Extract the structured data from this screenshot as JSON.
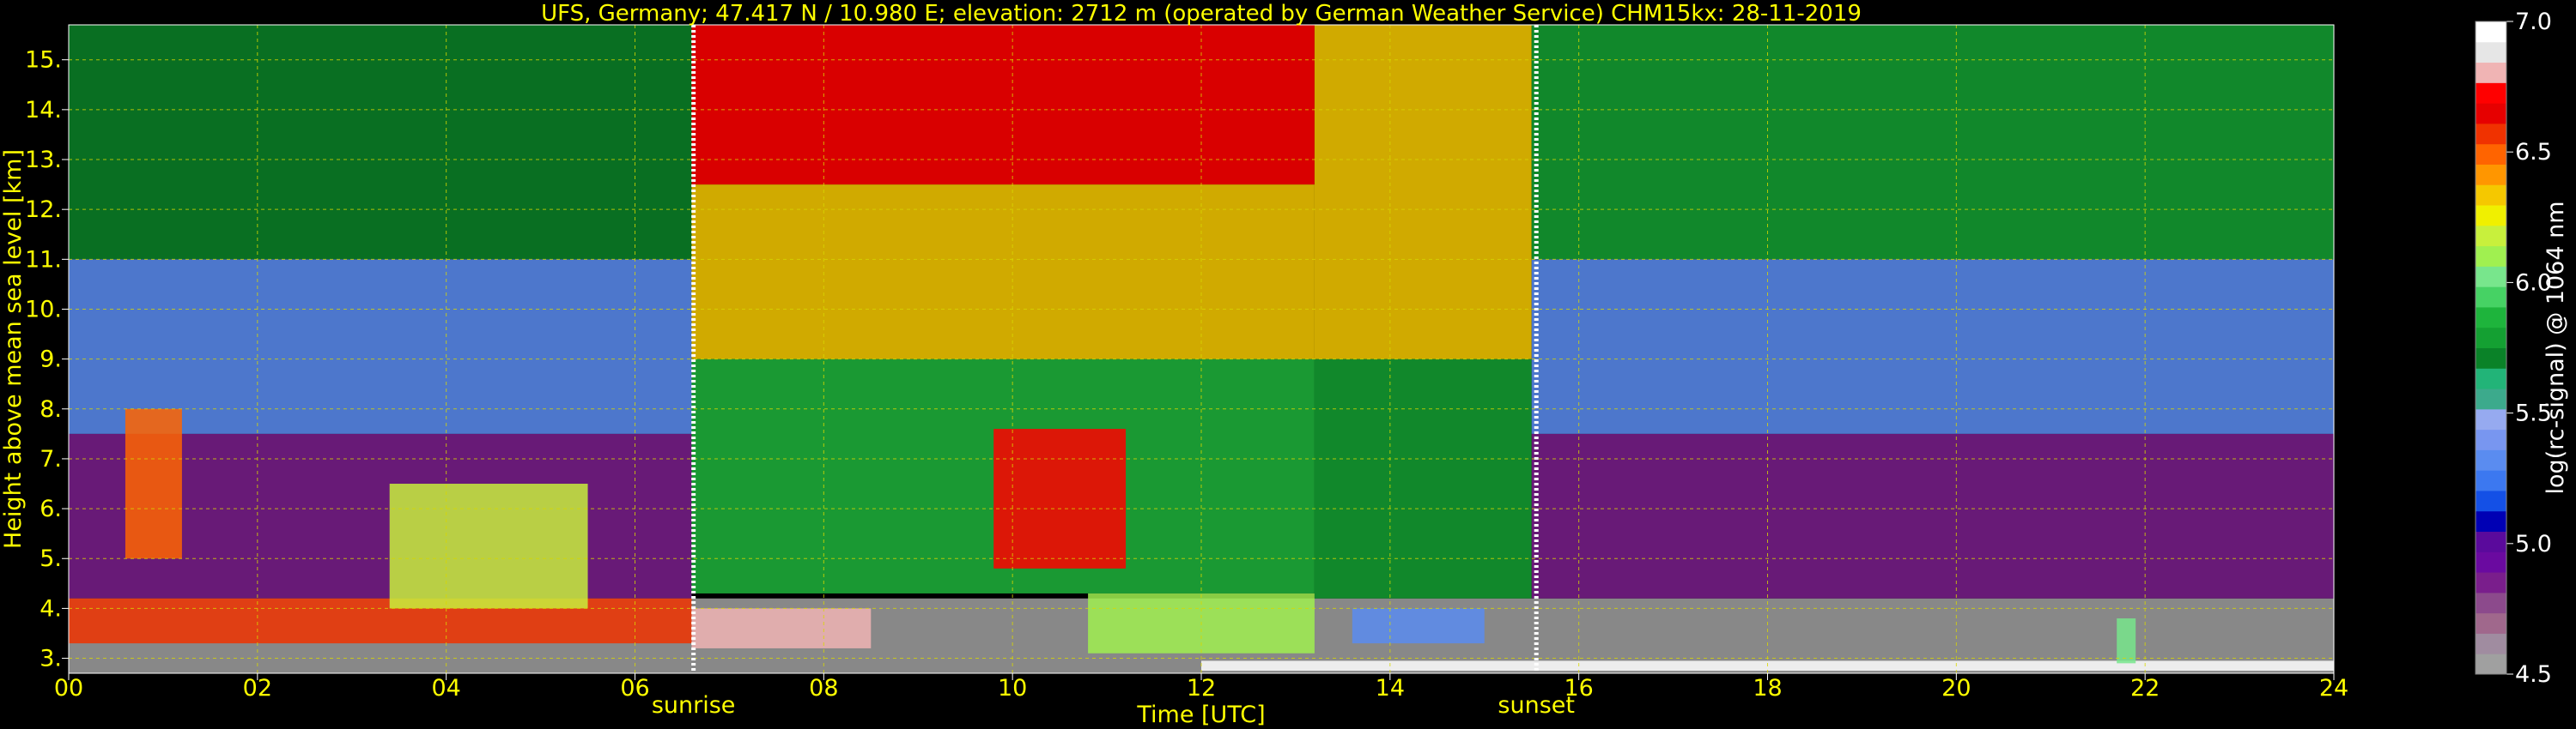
{
  "chart_data": {
    "type": "heatmap",
    "title": "UFS, Germany; 47.417 N / 10.980 E; elevation: 2712 m  (operated by German Weather Service)    CHM15kx: 28-11-2019",
    "xlabel": "Time [UTC]",
    "ylabel": "Height above mean sea level [km]",
    "xlim": [
      0,
      24
    ],
    "ylim": [
      2.7,
      15.7
    ],
    "x_ticks": [
      {
        "v": 0,
        "label": "00"
      },
      {
        "v": 2,
        "label": "02"
      },
      {
        "v": 4,
        "label": "04"
      },
      {
        "v": 6,
        "label": "06"
      },
      {
        "v": 8,
        "label": "08"
      },
      {
        "v": 10,
        "label": "10"
      },
      {
        "v": 12,
        "label": "12"
      },
      {
        "v": 14,
        "label": "14"
      },
      {
        "v": 16,
        "label": "16"
      },
      {
        "v": 18,
        "label": "18"
      },
      {
        "v": 20,
        "label": "20"
      },
      {
        "v": 22,
        "label": "22"
      },
      {
        "v": 24,
        "label": "24"
      }
    ],
    "y_ticks": [
      {
        "v": 3,
        "label": "3."
      },
      {
        "v": 4,
        "label": "4."
      },
      {
        "v": 5,
        "label": "5."
      },
      {
        "v": 6,
        "label": "6."
      },
      {
        "v": 7,
        "label": "7."
      },
      {
        "v": 8,
        "label": "8."
      },
      {
        "v": 9,
        "label": "9."
      },
      {
        "v": 10,
        "label": "10."
      },
      {
        "v": 11,
        "label": "11."
      },
      {
        "v": 12,
        "label": "12."
      },
      {
        "v": 13,
        "label": "13."
      },
      {
        "v": 14,
        "label": "14."
      },
      {
        "v": 15,
        "label": "15."
      }
    ],
    "grid": true,
    "markers": [
      {
        "label": "sunrise",
        "x": 6.62
      },
      {
        "label": "sunset",
        "x": 15.55
      }
    ],
    "colorbar": {
      "label": "log(rc-signal) @ 1064 nm",
      "range": [
        4.5,
        7.0
      ],
      "ticks": [
        {
          "v": 4.5,
          "label": "4.5"
        },
        {
          "v": 5.0,
          "label": "5.0"
        },
        {
          "v": 5.5,
          "label": "5.5"
        },
        {
          "v": 6.0,
          "label": "6.0"
        },
        {
          "v": 6.5,
          "label": "6.5"
        },
        {
          "v": 7.0,
          "label": "7.0"
        }
      ],
      "colors": [
        "#a0a0a0",
        "#a08ca0",
        "#a0688c",
        "#8c4a8c",
        "#7a1e8c",
        "#6a0aa0",
        "#5a0a9c",
        "#0000b4",
        "#1450e6",
        "#3c78f0",
        "#5a8cf0",
        "#7896f0",
        "#96aaf0",
        "#3caa8c",
        "#22b478",
        "#0a8228",
        "#14a032",
        "#1eb43c",
        "#46d264",
        "#78e68c",
        "#a0f050",
        "#c8f03c",
        "#f0f000",
        "#f5c800",
        "#ff9600",
        "#ff6400",
        "#f03200",
        "#e60000",
        "#ff0000",
        "#f0b4b4",
        "#e6e6e6",
        "#ffffff"
      ]
    },
    "regions": [
      {
        "t0": 0.0,
        "t1": 24.0,
        "h0": 2.7,
        "h1": 4.2,
        "value": 4.55
      },
      {
        "t0": 0.0,
        "t1": 6.6,
        "h0": 4.2,
        "h1": 7.5,
        "value": 4.85
      },
      {
        "t0": 0.0,
        "t1": 6.6,
        "h0": 7.5,
        "h1": 11.0,
        "value": 5.3
      },
      {
        "t0": 0.0,
        "t1": 6.6,
        "h0": 11.0,
        "h1": 15.7,
        "value": 5.7
      },
      {
        "t0": 6.6,
        "t1": 13.2,
        "h0": 4.3,
        "h1": 9.0,
        "value": 5.9
      },
      {
        "t0": 6.6,
        "t1": 13.2,
        "h0": 9.0,
        "h1": 12.5,
        "value": 6.35
      },
      {
        "t0": 6.6,
        "t1": 13.2,
        "h0": 12.5,
        "h1": 15.7,
        "value": 6.75
      },
      {
        "t0": 13.2,
        "t1": 15.5,
        "h0": 4.2,
        "h1": 9.0,
        "value": 5.75
      },
      {
        "t0": 13.2,
        "t1": 15.5,
        "h0": 9.0,
        "h1": 15.7,
        "value": 6.3
      },
      {
        "t0": 15.5,
        "t1": 24.0,
        "h0": 4.2,
        "h1": 7.5,
        "value": 4.85
      },
      {
        "t0": 15.5,
        "t1": 24.0,
        "h0": 7.5,
        "h1": 11.0,
        "value": 5.3
      },
      {
        "t0": 15.5,
        "t1": 24.0,
        "h0": 11.0,
        "h1": 15.7,
        "value": 5.75
      },
      {
        "t0": 0.0,
        "t1": 6.6,
        "h0": 3.3,
        "h1": 4.2,
        "value": 6.6
      },
      {
        "t0": 6.6,
        "t1": 8.5,
        "h0": 3.2,
        "h1": 4.0,
        "value": 6.8
      },
      {
        "t0": 3.4,
        "t1": 5.5,
        "h0": 4.0,
        "h1": 6.5,
        "value": 6.2
      },
      {
        "t0": 0.6,
        "t1": 1.2,
        "h0": 5.0,
        "h1": 8.0,
        "value": 6.5
      },
      {
        "t0": 10.8,
        "t1": 13.2,
        "h0": 3.1,
        "h1": 4.3,
        "value": 6.1
      },
      {
        "t0": 9.8,
        "t1": 11.2,
        "h0": 4.8,
        "h1": 7.6,
        "value": 6.7
      },
      {
        "t0": 13.6,
        "t1": 15.0,
        "h0": 3.3,
        "h1": 4.0,
        "value": 5.3
      },
      {
        "t0": 12.0,
        "t1": 24.0,
        "h0": 2.75,
        "h1": 2.95,
        "value": 7.0
      },
      {
        "t0": 21.7,
        "t1": 21.9,
        "h0": 2.9,
        "h1": 3.8,
        "value": 6.0
      }
    ]
  }
}
